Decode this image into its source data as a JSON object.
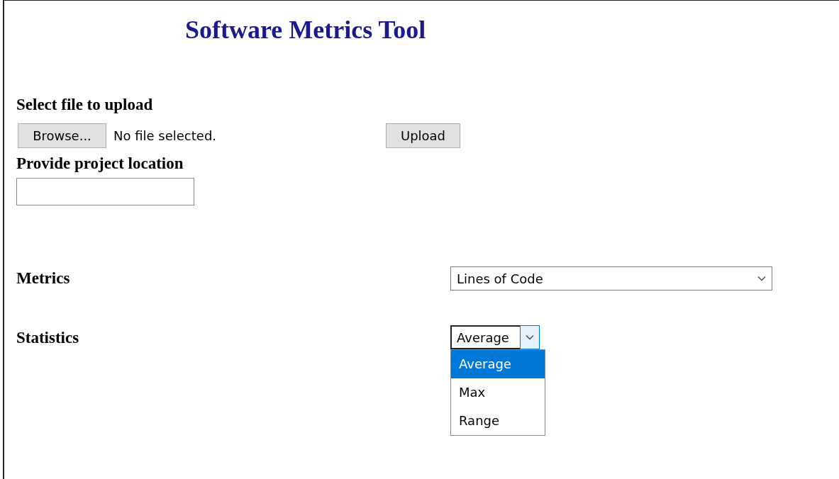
{
  "title": "Software Metrics Tool",
  "upload": {
    "label": "Select file to upload",
    "browse_button": "Browse...",
    "file_status": "No file selected.",
    "upload_button": "Upload"
  },
  "project_location": {
    "label": "Provide project location"
  },
  "metrics": {
    "label": "Metrics",
    "value": "Lines of Code"
  },
  "statistics": {
    "label": "Statistics",
    "value": "Average",
    "expanded": true,
    "options": [
      {
        "label": "Average",
        "selected": true
      },
      {
        "label": "Max",
        "selected": false
      },
      {
        "label": "Range",
        "selected": false
      }
    ]
  }
}
